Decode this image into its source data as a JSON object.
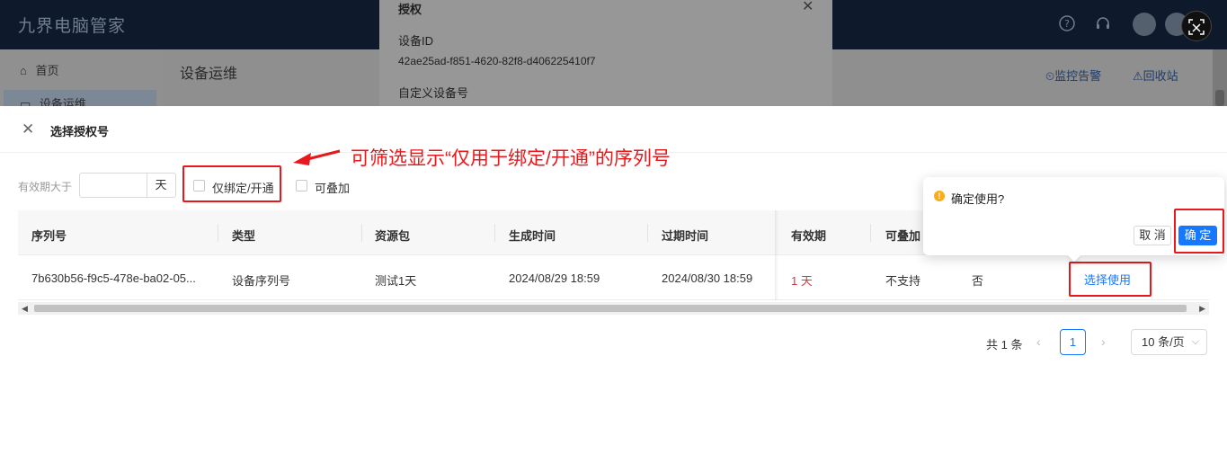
{
  "app": {
    "title": "九界电脑管家"
  },
  "topbar": {
    "icons": [
      "help-icon",
      "headset-icon",
      "bell-icon",
      "user-avatar",
      "translate-icon"
    ],
    "translate_glyph": "⊠"
  },
  "bg_page": {
    "nav_home": "首页",
    "nav_active": "设备运维",
    "page_title": "设备运维",
    "link_monitor": "监控告警",
    "link_recycle": "回收站"
  },
  "auth_panel": {
    "title": "授权",
    "device_id_label": "设备ID",
    "device_id_value": "42ae25ad-f851-4620-82f8-d406225410f7",
    "custom_label": "自定义设备号"
  },
  "drawer": {
    "title": "选择授权号",
    "filter": {
      "validity_label": "有效期大于",
      "validity_value": "",
      "validity_unit": "天",
      "only_bind_label": "仅绑定/开通",
      "stackable_label": "可叠加"
    },
    "annotation": "可筛选显示“仅用于绑定/开通”的序列号",
    "table": {
      "headers": [
        "序列号",
        "类型",
        "资源包",
        "生成时间",
        "过期时间",
        "有效期",
        "可叠加"
      ],
      "rows": [
        {
          "serial": "7b630b56-f9c5-478e-ba02-05...",
          "type": "设备序列号",
          "package": "测试1天",
          "created": "2024/08/29 18:59",
          "expires": "2024/08/30 18:59",
          "validity": "1 天",
          "stackable": "不支持",
          "extra": "否",
          "action": "选择使用"
        }
      ]
    },
    "pagination": {
      "total": "共 1 条",
      "current_page": "1",
      "page_size": "10 条/页"
    }
  },
  "popconfirm": {
    "message": "确定使用?",
    "cancel": "取 消",
    "ok": "确 定"
  },
  "colors": {
    "annotation_red": "#e8191c",
    "primary": "#1677ff",
    "warning": "#faad14",
    "topbar_bg": "#0e1a2b"
  }
}
